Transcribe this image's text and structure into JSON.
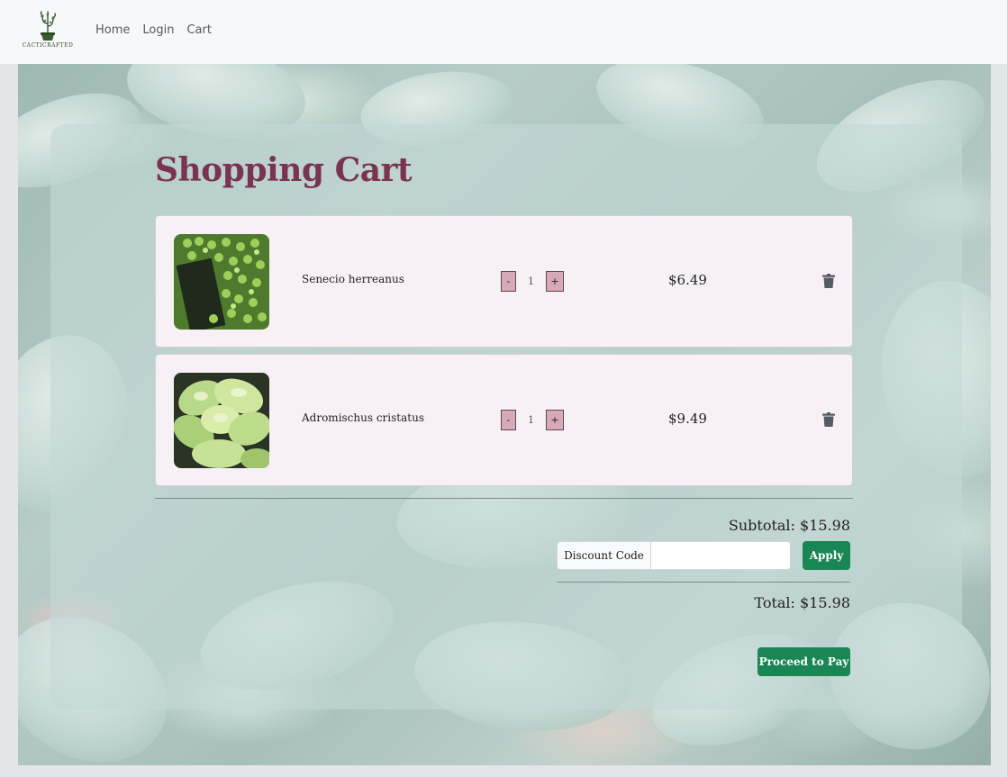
{
  "nav": {
    "brand_text": "CACTICRAFTED",
    "links": [
      "Home",
      "Login",
      "Cart"
    ]
  },
  "cart": {
    "title": "Shopping Cart",
    "items": [
      {
        "name": "Senecio herreanus",
        "quantity": "1",
        "price": "$6.49",
        "decrement_label": "-",
        "increment_label": "+"
      },
      {
        "name": "Adromischus cristatus",
        "quantity": "1",
        "price": "$9.49",
        "decrement_label": "-",
        "increment_label": "+"
      }
    ],
    "subtotal_text": "Subtotal: $15.98",
    "discount_label": "Discount Code",
    "discount_value": "",
    "apply_label": "Apply",
    "total_text": "Total: $15.98",
    "proceed_label": "Proceed to Pay"
  },
  "icons": {
    "logo": "cactus-logo-icon",
    "trash": "trash-icon"
  },
  "colors": {
    "title": "#7a3452",
    "accent_green": "#198754",
    "qty_button": "#d7a8b8",
    "card": "#f7f1f6"
  }
}
